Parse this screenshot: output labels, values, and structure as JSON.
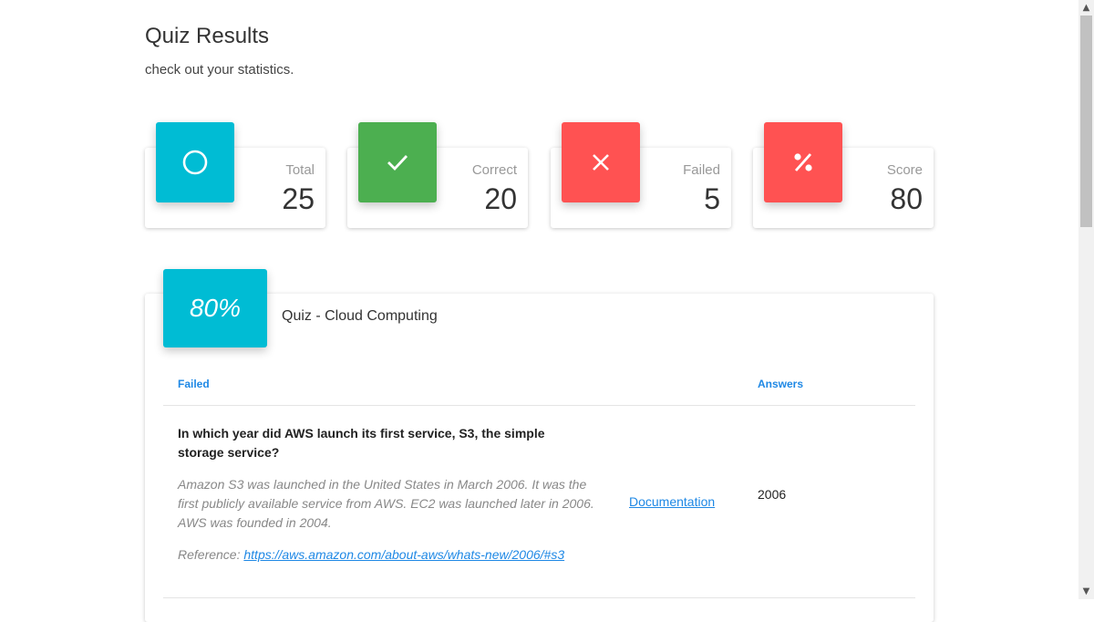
{
  "header": {
    "title": "Quiz Results",
    "subtitle": "check out your statistics."
  },
  "stats": [
    {
      "label": "Total",
      "value": "25",
      "icon": "circle-icon",
      "color": "#00bcd4"
    },
    {
      "label": "Correct",
      "value": "20",
      "icon": "check-icon",
      "color": "#4caf50"
    },
    {
      "label": "Failed",
      "value": "5",
      "icon": "close-icon",
      "color": "#ff5252"
    },
    {
      "label": "Score",
      "value": "80",
      "icon": "percent-icon",
      "color": "#ff5252"
    }
  ],
  "quiz": {
    "score": "80%",
    "title": "Quiz - Cloud Computing",
    "columns": {
      "failed": "Failed",
      "answers": "Answers"
    },
    "rows": [
      {
        "question": "In which year did AWS launch its first service, S3, the simple storage service?",
        "explanation": "Amazon S3 was launched in the United States in March 2006. It was the first publicly available service from AWS. EC2 was launched later in 2006. AWS was founded in 2004.",
        "reference_label": "Reference:",
        "reference_url": "https://aws.amazon.com/about-aws/whats-new/2006/#s3",
        "doc_link": "Documentation",
        "answer": "2006"
      }
    ]
  },
  "scrollbar": {
    "up": "▲",
    "down": "▼"
  }
}
